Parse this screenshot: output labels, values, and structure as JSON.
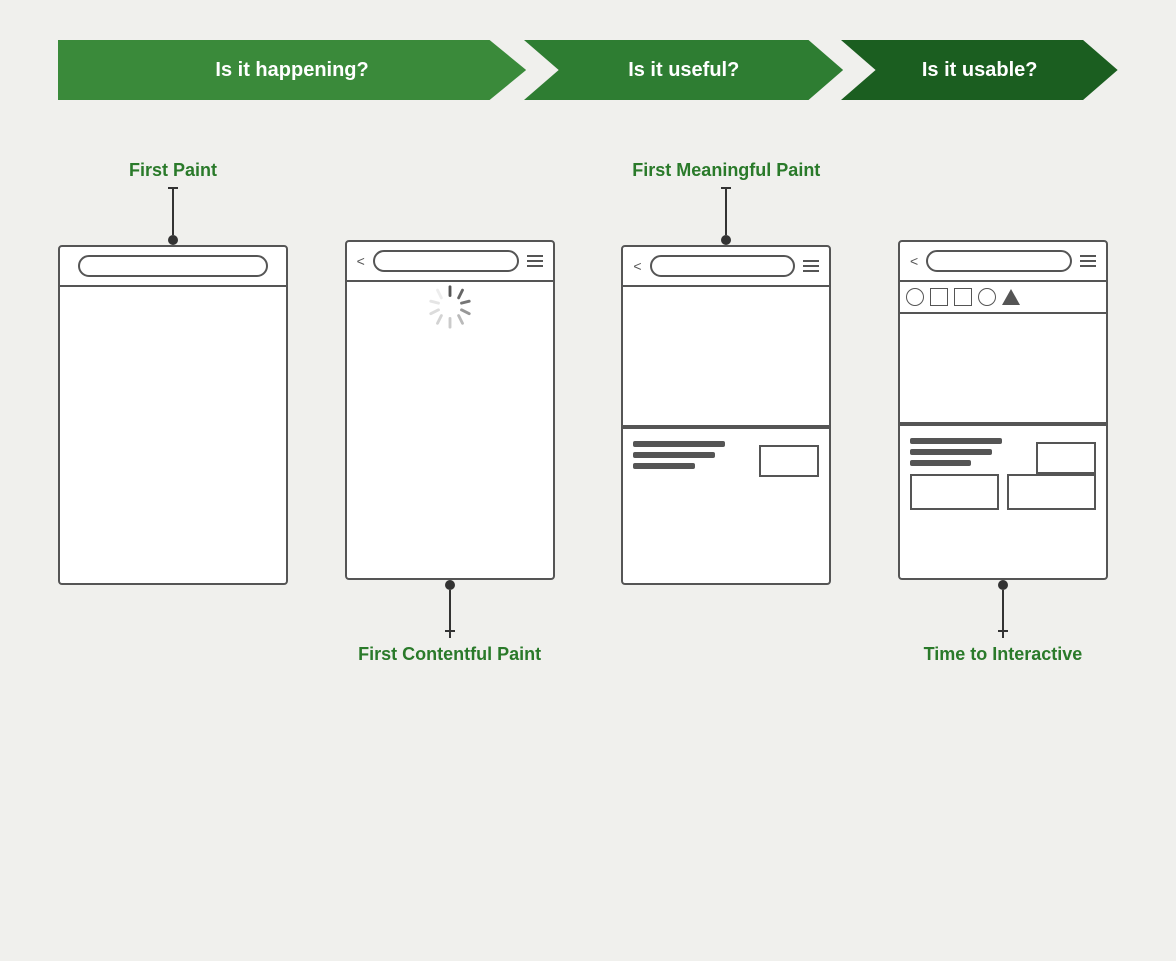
{
  "banner": {
    "arrow1": {
      "label": "Is it happening?",
      "color_dark": "#2e7d32",
      "color_light": "#388e3c"
    },
    "arrow2": {
      "label": "Is it useful?",
      "color_dark": "#2e7d32",
      "color_light": "#388e3c"
    },
    "arrow3": {
      "label": "Is it usable?",
      "color_dark": "#1b5e20",
      "color_light": "#2e7d32"
    }
  },
  "metrics": {
    "first_paint": "First Paint",
    "first_contentful_paint": "First Contentful Paint",
    "first_meaningful_paint": "First Meaningful Paint",
    "time_to_interactive": "Time to Interactive"
  },
  "bg_color": "#f0f0ed",
  "green_color": "#2a7a2a"
}
